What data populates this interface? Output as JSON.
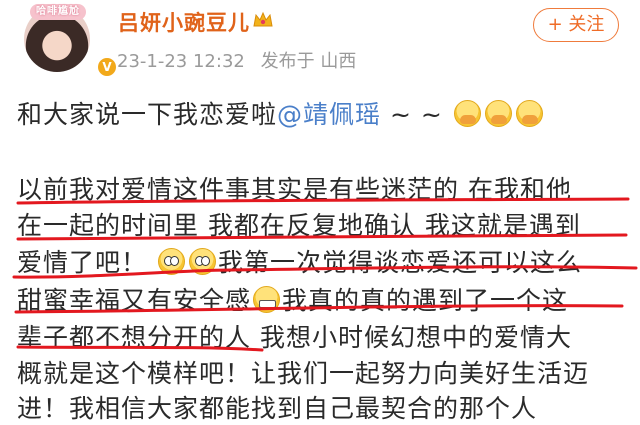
{
  "header": {
    "avatar_badge": "哈啡尴尬",
    "username": "吕妍小豌豆儿",
    "date": "23-1-23 12:32",
    "posted_from": "发布于 山西",
    "follow_label": "+ 关注"
  },
  "post": {
    "intro_text": "和大家说一下我恋爱啦",
    "mention": "@靖佩瑶",
    "intro_tail": " ~ ~",
    "lines": [
      "以前我对爱情这件事其实是有些迷茫的  在我和他",
      "在一起的时间里 我都在反复地确认 我这就是遇到",
      "爱情了吧！",
      "我第一次觉得谈恋爱还可以这么",
      "甜蜜幸福又有安全感",
      "我真的真的遇到了一个这",
      "辈子都不想分开的人  我想小时候幻想中的爱情大",
      "概就是这个模样吧！让我们一起努力向美好生活迈",
      "进！我相信大家都能找到自己最契合的那个人"
    ]
  },
  "colors": {
    "username": "#e0631a",
    "mention": "#4a7fc9",
    "underline": "#e3181f"
  }
}
